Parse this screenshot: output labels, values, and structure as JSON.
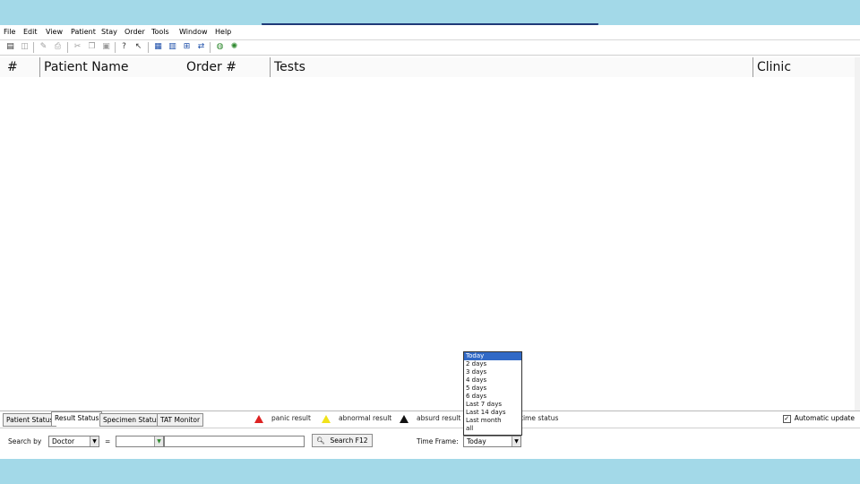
{
  "menu": [
    "File",
    "Edit",
    "View",
    "Patient",
    "Stay",
    "Order",
    "Tools",
    "Window",
    "Help"
  ],
  "toolbar_icons": [
    {
      "name": "open-folder-icon",
      "glyph": "▤"
    },
    {
      "name": "save-icon",
      "glyph": "◫"
    },
    {
      "name": "edit-icon",
      "glyph": "✎"
    },
    {
      "name": "print-icon",
      "glyph": "⎙"
    },
    {
      "name": "cut-icon",
      "glyph": "✂"
    },
    {
      "name": "copy-icon",
      "glyph": "❐"
    },
    {
      "name": "paste-icon",
      "glyph": "▣"
    },
    {
      "name": "help-icon",
      "glyph": "?"
    },
    {
      "name": "context-help-icon",
      "glyph": "↖"
    },
    {
      "name": "patient-icon",
      "glyph": "▦"
    },
    {
      "name": "order-icon",
      "glyph": "▥"
    },
    {
      "name": "network-icon",
      "glyph": "⊞"
    },
    {
      "name": "transfer-icon",
      "glyph": "⇄"
    },
    {
      "name": "globe-icon",
      "glyph": "◍"
    },
    {
      "name": "gear-icon",
      "glyph": "✺"
    }
  ],
  "table": {
    "columns": [
      "#",
      "Patient Name",
      "Order #",
      "Tests",
      "Clinic"
    ],
    "rows": []
  },
  "tabs": [
    "Patient Status",
    "Result Status",
    "Specimen Status",
    "TAT Monitor"
  ],
  "active_tab": "Result Status",
  "legend": [
    {
      "label": "panic result",
      "color": "#d22222"
    },
    {
      "label": "abnormal result",
      "color": "#f1e21a"
    },
    {
      "label": "absurd result",
      "color": "#111111"
    },
    {
      "label": "time status",
      "color": ""
    }
  ],
  "auto_update": {
    "label": "Automatic update",
    "checked": true
  },
  "search": {
    "label": "Search by",
    "by_value": "Doctor",
    "separator": "=",
    "value": "",
    "button_label": "Search F12"
  },
  "time_frame": {
    "label": "Time Frame:",
    "value": "Today",
    "options": [
      "Today",
      "2 days",
      "3 days",
      "4 days",
      "5 days",
      "6 days",
      "Last 7 days",
      "Last 14 days",
      "Last month",
      "all"
    ],
    "highlighted": "Today"
  }
}
